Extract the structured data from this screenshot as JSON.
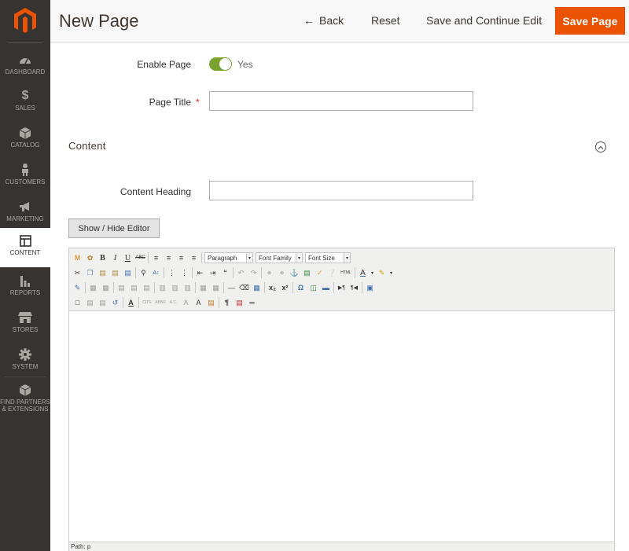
{
  "sidebar": {
    "items": [
      {
        "label": "DASHBOARD",
        "icon": "dashboard-icon"
      },
      {
        "label": "SALES",
        "icon": "dollar-icon"
      },
      {
        "label": "CATALOG",
        "icon": "box-icon"
      },
      {
        "label": "CUSTOMERS",
        "icon": "person-icon"
      },
      {
        "label": "MARKETING",
        "icon": "megaphone-icon"
      },
      {
        "label": "CONTENT",
        "icon": "layout-icon"
      },
      {
        "label": "REPORTS",
        "icon": "bar-chart-icon"
      },
      {
        "label": "STORES",
        "icon": "storefront-icon"
      },
      {
        "label": "SYSTEM",
        "icon": "gear-icon"
      },
      {
        "label_line1": "FIND PARTNERS",
        "label_line2": "& EXTENSIONS",
        "icon": "box-icon"
      }
    ]
  },
  "header": {
    "title": "New Page",
    "back_label": "Back",
    "reset_label": "Reset",
    "save_continue_label": "Save and Continue Edit",
    "save_label": "Save Page"
  },
  "form": {
    "enable_label": "Enable Page",
    "enable_value": "Yes",
    "title_label": "Page Title",
    "required_mark": "*",
    "title_value": ""
  },
  "content": {
    "section_title": "Content",
    "heading_label": "Content Heading",
    "heading_value": "",
    "editor_toggle_label": "Show / Hide Editor"
  },
  "editor": {
    "format_select": "Paragraph",
    "font_family_select": "Font Family",
    "font_size_select": "Font Size",
    "status_path": "Path: p"
  },
  "colors": {
    "accent": "#eb5202",
    "toggle_on": "#79a22e",
    "sidebar_bg": "#373330"
  }
}
